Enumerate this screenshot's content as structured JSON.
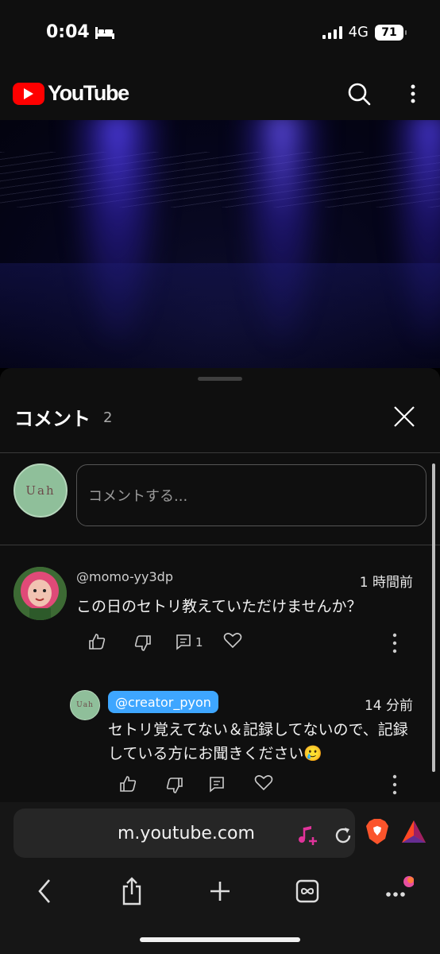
{
  "status_bar": {
    "time": "0:04",
    "network": "4G",
    "battery": "71"
  },
  "header": {
    "logo_text": "YouTube",
    "icons": [
      "search-icon",
      "more-vert-icon"
    ]
  },
  "comments_panel": {
    "title": "コメント",
    "count": "2",
    "input_placeholder": "コメントする...",
    "my_avatar_text": "Uah",
    "comments": [
      {
        "author": "@momo-yy3dp",
        "time": "1 時間前",
        "text": "この日のセトリ教えていただけませんか？",
        "reply_count": "1"
      }
    ],
    "replies": [
      {
        "author": "@creator_pyon",
        "time": "14 分前",
        "text": "セトリ覚えてない＆記録してないので、記録している方にお聞きください🥲"
      }
    ]
  },
  "browser": {
    "url": "m.youtube.com"
  },
  "colors": {
    "yt_red": "#ff0000",
    "creator_badge": "#3ea6ff",
    "panel_bg": "#0f0f0f"
  }
}
